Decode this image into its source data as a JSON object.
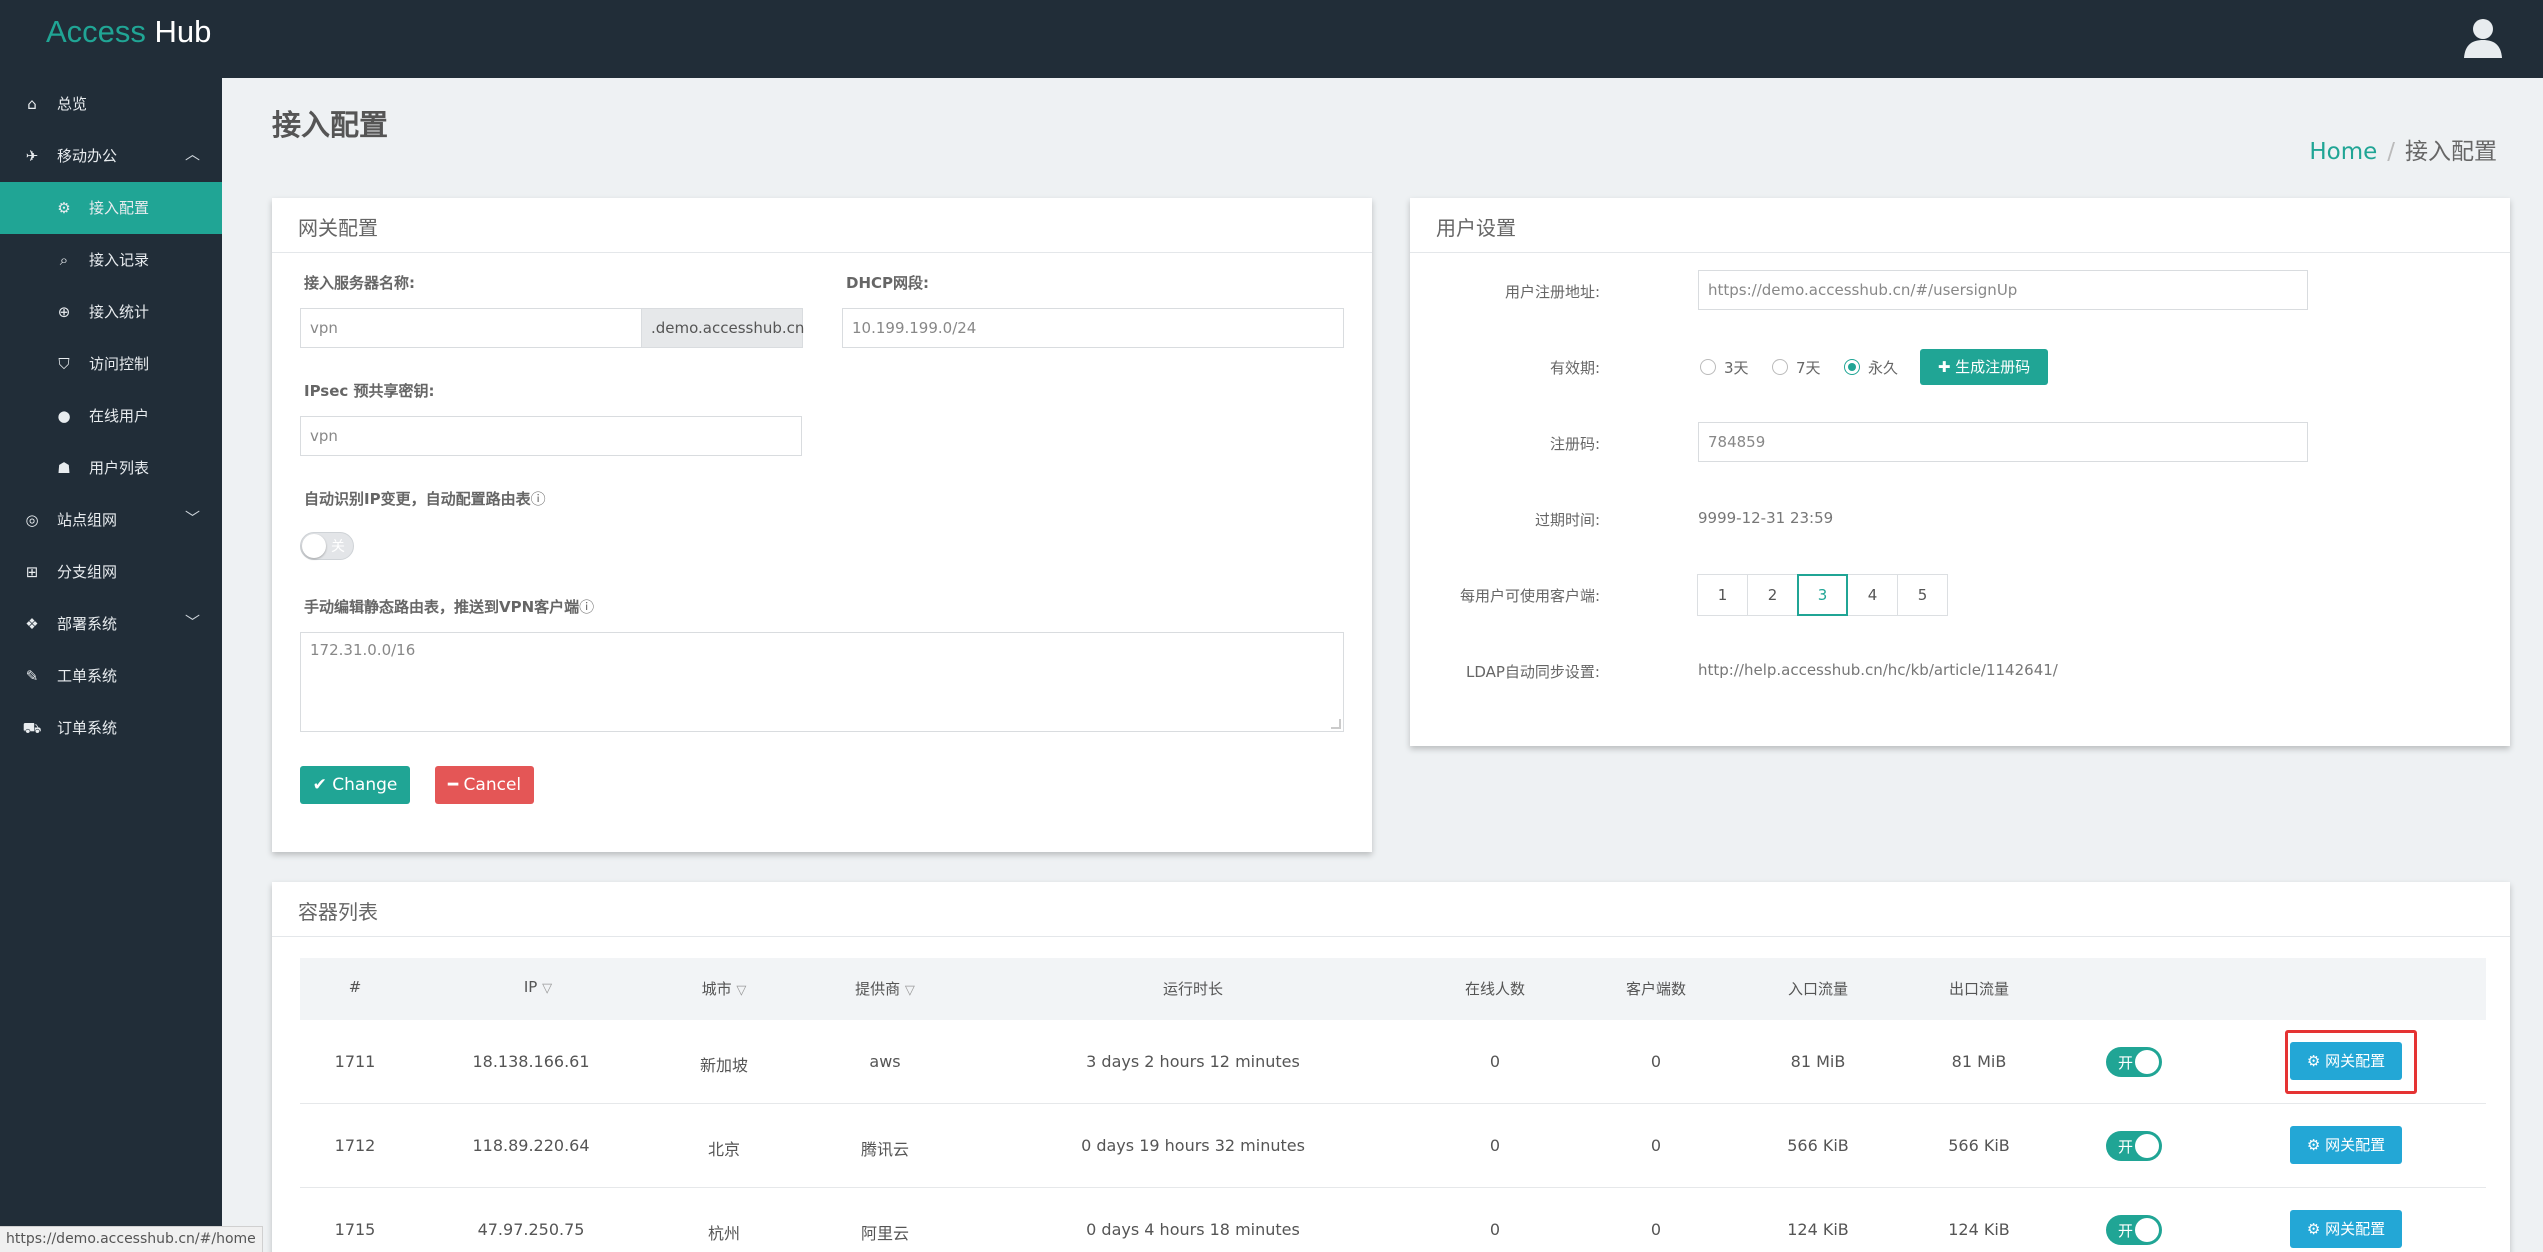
{
  "app": {
    "brand_part1": "Access",
    "brand_part2": "Hub",
    "user_icon": "user-icon"
  },
  "sidebar": {
    "items": [
      {
        "label": "总览",
        "icon": "home-icon"
      },
      {
        "label": "移动办公",
        "icon": "plane-icon",
        "expanded": true
      },
      {
        "label": "接入配置",
        "icon": "cogs-icon",
        "active": true
      },
      {
        "label": "接入记录",
        "icon": "search-icon"
      },
      {
        "label": "接入统计",
        "icon": "zoom-icon"
      },
      {
        "label": "访问控制",
        "icon": "shield-icon"
      },
      {
        "label": "在线用户",
        "icon": "user-icon"
      },
      {
        "label": "用户列表",
        "icon": "users-icon"
      },
      {
        "label": "站点组网",
        "icon": "network-icon"
      },
      {
        "label": "分支组网",
        "icon": "sitemap-icon"
      },
      {
        "label": "部署系统",
        "icon": "cubes-icon"
      },
      {
        "label": "工单系统",
        "icon": "wrench-icon"
      },
      {
        "label": "订单系统",
        "icon": "cart-icon"
      }
    ]
  },
  "header": {
    "title": "接入配置",
    "breadcrumb_home": "Home",
    "breadcrumb_sep": "/",
    "breadcrumb_current": "接入配置"
  },
  "gateway": {
    "title": "网关配置",
    "server_name_label": "接入服务器名称:",
    "server_name_value": "vpn",
    "server_name_suffix": ".demo.accesshub.cn",
    "dhcp_label": "DHCP网段:",
    "dhcp_value": "10.199.199.0/24",
    "ipsec_label": "IPsec 预共享密钥:",
    "ipsec_value": "vpn",
    "auto_route_label": "自动识别IP变更，自动配置路由表",
    "auto_route_toggle": "关",
    "static_route_label": "手动编辑静态路由表，推送到VPN客户端",
    "static_route_value": "172.31.0.0/16",
    "change_label": "Change",
    "cancel_label": "Cancel"
  },
  "user_settings": {
    "title": "用户设置",
    "reg_url_label": "用户注册地址:",
    "reg_url_value": "https://demo.accesshub.cn/#/usersignUp",
    "validity_label": "有效期:",
    "validity_options": [
      "3天",
      "7天",
      "永久"
    ],
    "validity_selected": "永久",
    "gen_code_label": "生成注册码",
    "reg_code_label": "注册码:",
    "reg_code_value": "784859",
    "expire_label": "过期时间:",
    "expire_value": "9999-12-31 23:59",
    "clients_label": "每用户可使用客户端:",
    "clients_options": [
      "1",
      "2",
      "3",
      "4",
      "5"
    ],
    "clients_selected": "3",
    "ldap_label": "LDAP自动同步设置:",
    "ldap_value": "http://help.accesshub.cn/hc/kb/article/1142641/"
  },
  "containers": {
    "title": "容器列表",
    "columns": [
      "#",
      "IP",
      "城市",
      "提供商",
      "运行时长",
      "在线人数",
      "客户端数",
      "入口流量",
      "出口流量"
    ],
    "filter_icon": "filter-icon",
    "rows": [
      {
        "id": "1711",
        "ip": "18.138.166.61",
        "city": "新加坡",
        "provider": "aws",
        "uptime": "3 days 2 hours 12 minutes",
        "online": "0",
        "clients": "0",
        "in": "81 MiB",
        "out": "81 MiB",
        "toggle": "开",
        "action": "网关配置"
      },
      {
        "id": "1712",
        "ip": "118.89.220.64",
        "city": "北京",
        "provider": "腾讯云",
        "uptime": "0 days 19 hours 32 minutes",
        "online": "0",
        "clients": "0",
        "in": "566 KiB",
        "out": "566 KiB",
        "toggle": "开",
        "action": "网关配置"
      },
      {
        "id": "1715",
        "ip": "47.97.250.75",
        "city": "杭州",
        "provider": "阿里云",
        "uptime": "0 days 4 hours 18 minutes",
        "online": "0",
        "clients": "0",
        "in": "124 KiB",
        "out": "124 KiB",
        "toggle": "开",
        "action": "网关配置"
      }
    ]
  },
  "statusbar": {
    "url": "https://demo.accesshub.cn/#/home"
  }
}
